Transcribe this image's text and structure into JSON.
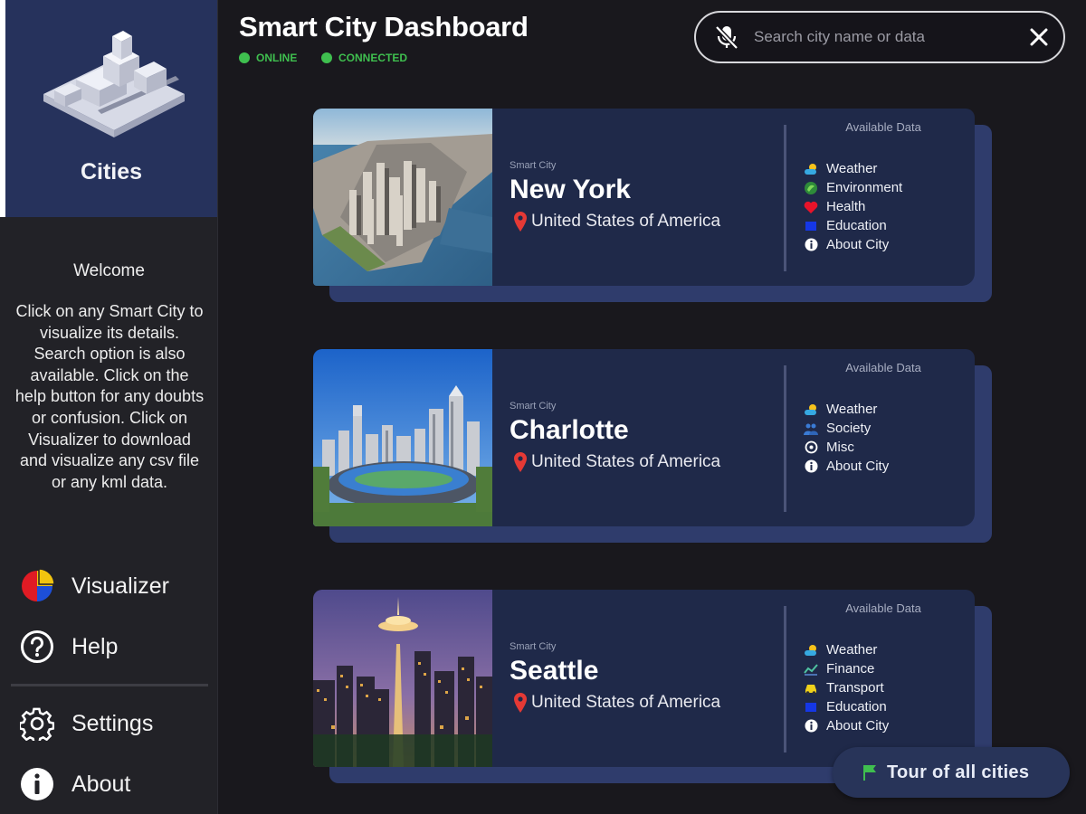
{
  "sidebar": {
    "cities_label": "Cities",
    "welcome_title": "Welcome",
    "welcome_text": "Click on any Smart City to visualize its details. Search option is also available. Click on the help button for any doubts or confusion. Click on Visualizer to download and visualize any csv file or any kml data.",
    "nav": [
      {
        "label": "Visualizer",
        "icon": "pie-chart-icon"
      },
      {
        "label": "Help",
        "icon": "help-icon"
      },
      {
        "label": "Settings",
        "icon": "gear-icon"
      },
      {
        "label": "About",
        "icon": "info-icon"
      }
    ]
  },
  "header": {
    "title": "Smart City Dashboard",
    "status": [
      "ONLINE",
      "CONNECTED"
    ],
    "status_color": "#3fbf4f"
  },
  "search": {
    "placeholder": "Search city name or data",
    "value": ""
  },
  "cards": [
    {
      "subtitle": "Smart City",
      "name": "New York",
      "country": "United States of America",
      "available_title": "Available Data",
      "items": [
        {
          "label": "Weather",
          "icon": "weather-icon"
        },
        {
          "label": "Environment",
          "icon": "environment-icon"
        },
        {
          "label": "Health",
          "icon": "heart-icon"
        },
        {
          "label": "Education",
          "icon": "education-icon"
        },
        {
          "label": "About City",
          "icon": "info-icon"
        }
      ]
    },
    {
      "subtitle": "Smart City",
      "name": "Charlotte",
      "country": "United States of America",
      "available_title": "Available Data",
      "items": [
        {
          "label": "Weather",
          "icon": "weather-icon"
        },
        {
          "label": "Society",
          "icon": "society-icon"
        },
        {
          "label": "Misc",
          "icon": "misc-icon"
        },
        {
          "label": "About City",
          "icon": "info-icon"
        }
      ]
    },
    {
      "subtitle": "Smart City",
      "name": "Seattle",
      "country": "United States of America",
      "available_title": "Available Data",
      "items": [
        {
          "label": "Weather",
          "icon": "weather-icon"
        },
        {
          "label": "Finance",
          "icon": "finance-icon"
        },
        {
          "label": "Transport",
          "icon": "transport-icon"
        },
        {
          "label": "Education",
          "icon": "education-icon"
        },
        {
          "label": "About City",
          "icon": "info-icon"
        }
      ]
    }
  ],
  "tour": {
    "label": "Tour of all cities",
    "icon": "flag-icon"
  },
  "colors": {
    "background": "#19181d",
    "sidebar": "#222227",
    "accent": "#26325c",
    "card": "#1f2949",
    "card_shadow": "#2f3c6c",
    "pin": "#e53935"
  }
}
